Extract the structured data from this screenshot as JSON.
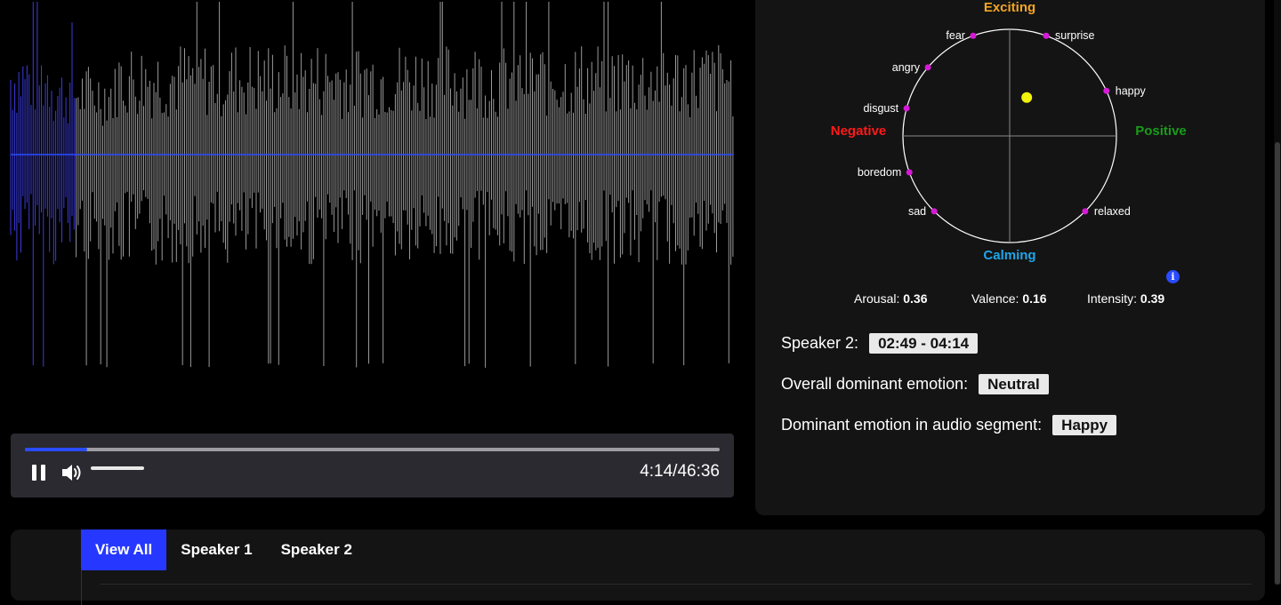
{
  "waveform": {
    "played_fraction": 0.089,
    "played_color": "#3b3be0",
    "unplayed_color": "#9a9a9a",
    "center_line_color": "#2a4bff"
  },
  "player": {
    "pause_icon": "pause-icon",
    "volume_icon": "volume-icon",
    "progress_fraction": 0.089,
    "volume_fraction": 1.0,
    "time_display": "4:14/46:36"
  },
  "emotion_wheel": {
    "labels": {
      "top": "Exciting",
      "bottom": "Calming",
      "left": "Negative",
      "right": "Positive"
    },
    "colors": {
      "top": "#f5a623",
      "bottom": "#1fa5e8",
      "left": "#ff1a1a",
      "right": "#1a9c1a",
      "points": "#d61ad6",
      "current": "#f2f20a"
    },
    "emotions": [
      {
        "name": "fear",
        "angle": 110
      },
      {
        "name": "surprise",
        "angle": 70
      },
      {
        "name": "angry",
        "angle": 140
      },
      {
        "name": "happy",
        "angle": 25
      },
      {
        "name": "disgust",
        "angle": 165
      },
      {
        "name": "boredom",
        "angle": 200
      },
      {
        "name": "sad",
        "angle": 225
      },
      {
        "name": "relaxed",
        "angle": 315
      }
    ],
    "current_point": {
      "valence": 0.16,
      "arousal": 0.36
    }
  },
  "metrics": {
    "arousal_label": "Arousal:",
    "arousal_value": "0.36",
    "valence_label": "Valence:",
    "valence_value": "0.16",
    "intensity_label": "Intensity:",
    "intensity_value": "0.39",
    "info_icon": "info-icon",
    "info_glyph": "i"
  },
  "details": {
    "speaker_label": "Speaker 2:",
    "speaker_range": "02:49 - 04:14",
    "overall_label": "Overall dominant emotion:",
    "overall_value": "Neutral",
    "segment_label": "Dominant emotion in audio segment:",
    "segment_value": "Happy"
  },
  "tabs": [
    {
      "label": "View All",
      "active": true
    },
    {
      "label": "Speaker 1",
      "active": false
    },
    {
      "label": "Speaker 2",
      "active": false
    }
  ]
}
